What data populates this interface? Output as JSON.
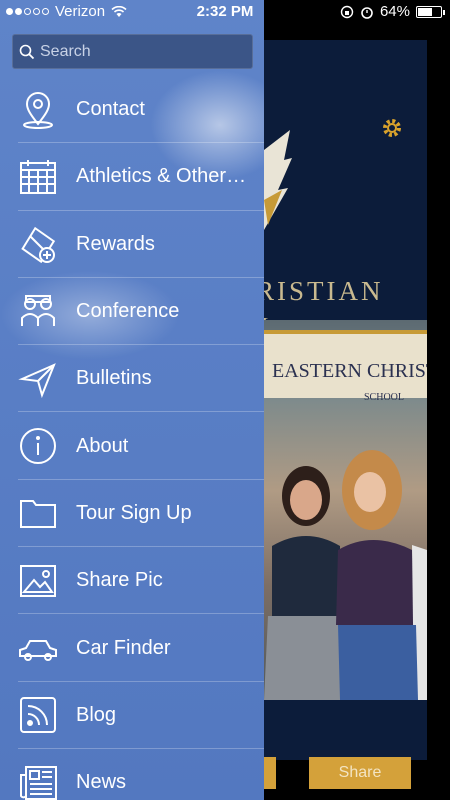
{
  "status_bar": {
    "carrier": "Verizon",
    "time": "2:32 PM",
    "battery": "64%",
    "battery_level": 0.64
  },
  "search": {
    "placeholder": "Search"
  },
  "menu": {
    "items": [
      {
        "label": "Contact",
        "icon": "location-pin-icon"
      },
      {
        "label": "Athletics & Other Events",
        "icon": "calendar-icon"
      },
      {
        "label": "Rewards",
        "icon": "ticket-icon"
      },
      {
        "label": "Conference",
        "icon": "people-icon"
      },
      {
        "label": "Bulletins",
        "icon": "paper-plane-icon"
      },
      {
        "label": "About",
        "icon": "info-icon"
      },
      {
        "label": "Tour Sign Up",
        "icon": "folder-icon"
      },
      {
        "label": "Share Pic",
        "icon": "image-icon"
      },
      {
        "label": "Car Finder",
        "icon": "car-icon"
      },
      {
        "label": "Blog",
        "icon": "rss-icon"
      },
      {
        "label": "News",
        "icon": "newspaper-icon"
      }
    ]
  },
  "background": {
    "school_name": "RISTIAN",
    "school_sub": "L",
    "banner_text": "EASTERN CHRISTI",
    "banner_small": "SCHOOL",
    "share_label": "Share"
  },
  "colors": {
    "drawer": "#5a7fc6",
    "accent": "#d4a13a",
    "panel": "#0c1c3a"
  }
}
